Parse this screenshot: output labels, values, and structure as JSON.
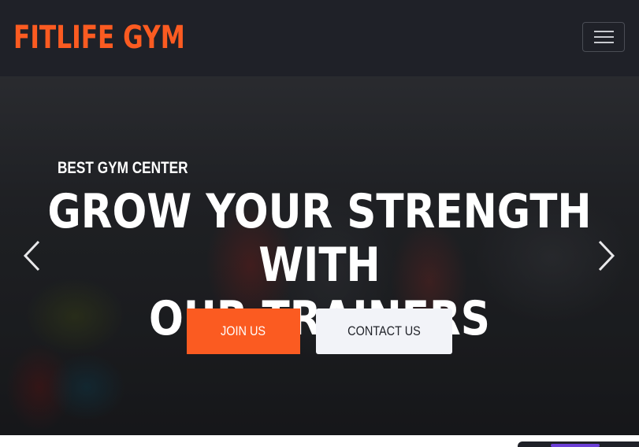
{
  "navbar": {
    "brand": "FITLIFE GYM",
    "toggler_icon": "hamburger-menu-icon"
  },
  "hero": {
    "subtitle": "BEST GYM CENTER",
    "title_line1": "GROW YOUR STRENGTH WITH",
    "title_line2": "OUR TRAINERS",
    "join_label": "JOIN US",
    "contact_label": "CONTACT US",
    "prev_icon": "chevron-left-icon",
    "next_icon": "chevron-right-icon"
  },
  "colors": {
    "navbar_bg": "#1f2128",
    "brand": "#fb5b21",
    "primary_button": "#fb5b21",
    "secondary_button": "#f2f3f8",
    "hero_text": "#ffffff"
  }
}
